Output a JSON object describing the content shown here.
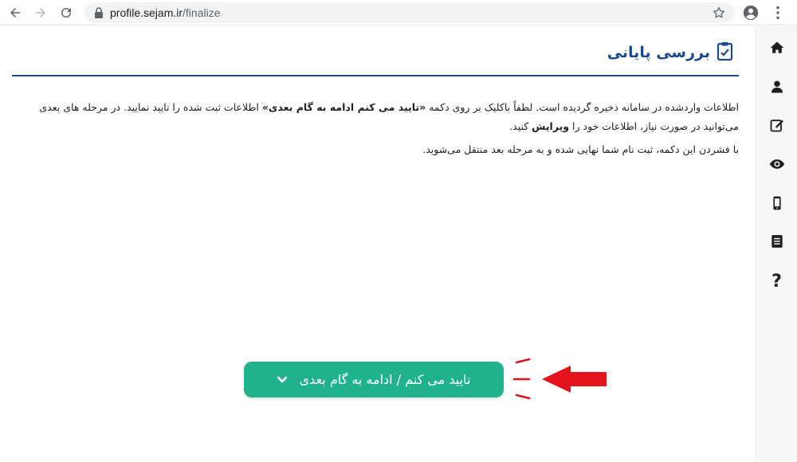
{
  "browser": {
    "url_host": "profile.sejam.ir",
    "url_path": "/finalize"
  },
  "page": {
    "title": "بررسی پایانی",
    "paragraph1": {
      "part1": "اطلاعات واردشده در سامانه ذخیره گردیده است. لطفاً باکلیک بر روی دکمه ",
      "bold1": "«تایید می کنم ادامه به گام بعدی»",
      "part2": "  اطلاعات ثبت شده را تایید نمایید. در مرحله های بعدی می‌توانید در صورت نیاز، اطلاعات خود را ",
      "bold2": "ویرایش",
      "part3": " کنید."
    },
    "paragraph2": "با فشردن این دکمه، ثبت نام شما نهایی شده و به مرحله بعد منتقل می‌شوید.",
    "confirm_label": "تایید می کنم / ادامه به گام بعدی"
  },
  "sidebar": {
    "items": [
      {
        "icon": "home-icon"
      },
      {
        "icon": "user-icon"
      },
      {
        "icon": "edit-icon"
      },
      {
        "icon": "eye-icon"
      },
      {
        "icon": "mobile-icon"
      },
      {
        "icon": "document-icon"
      },
      {
        "icon": "question-icon",
        "label": "?"
      }
    ]
  },
  "colors": {
    "brand_blue": "#1e4a8c",
    "button_green": "#20b28a",
    "annotation_red": "#e3141b"
  }
}
